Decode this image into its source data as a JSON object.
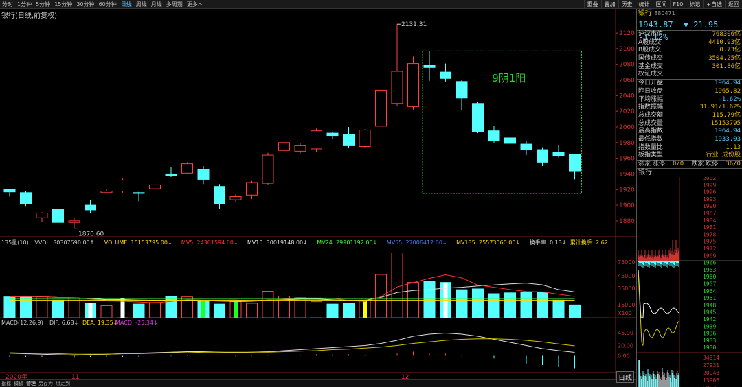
{
  "toolbar": {
    "periods": [
      "分时",
      "1分钟",
      "5分钟",
      "15分钟",
      "30分钟",
      "60分钟",
      "日线",
      "周线",
      "月线",
      "多周期",
      "更多>"
    ],
    "active_period": "日线",
    "right_buttons": [
      "重叠",
      "叠加",
      "历史",
      "统计",
      "区间",
      "F10",
      "标记",
      "+自选",
      "返回"
    ]
  },
  "chart_title": "银行(日线,前复权)",
  "annotations": {
    "high_label": "2131.31",
    "low_label": "1870.60",
    "pattern_text": "9阴1阳"
  },
  "price_axis": [
    "2120",
    "2100",
    "2080",
    "2060",
    "2040",
    "2020",
    "2000",
    "1980",
    "1960",
    "1940",
    "1920",
    "1900",
    "1880"
  ],
  "volume_header": {
    "ind": "135量(10)",
    "vvol": "VVOL: 30307590.00↑",
    "volume": "VOLUME: 15153795.00↓",
    "mv5": "MV5: 24301594.00↓",
    "mv10": "MV10: 30019148.00↓",
    "mv24": "MV24: 29901192.00↓",
    "mv55": "MV55: 27006412.00↓",
    "mv135": "MV135: 25573060.00↓",
    "hsl": "换手率: 0.13↓",
    "ljhs": "累计换手: 2.62"
  },
  "volume_axis": [
    "75000",
    "45000",
    "35000",
    "15000",
    "X100"
  ],
  "macd_header": {
    "name": "MACD(12,26,9)",
    "dif": "DIF: 6.68↓",
    "dea": "DEA: 19.35↓",
    "macd": "MACD: -25.34↓"
  },
  "macd_axis": [
    "45.00",
    "20.00",
    "0.00"
  ],
  "time_axis": [
    "2020年",
    "11",
    "12"
  ],
  "bottom_tabs": [
    "指标",
    "模板",
    "管理",
    "另存为",
    "绑定到"
  ],
  "day_button": "日线",
  "side": {
    "name": "银行",
    "code": "880471",
    "price": "1943.87",
    "change": "▼-21.95",
    "pct": "-1.12%",
    "stats1": [
      {
        "k": "沪深市值",
        "v": "768306亿"
      },
      {
        "k": "A股成交",
        "v": "4410.93亿"
      },
      {
        "k": "B股成交",
        "v": "0.73亿"
      },
      {
        "k": "国债成交",
        "v": "3504.25亿"
      },
      {
        "k": "基金成交",
        "v": "301.86亿"
      },
      {
        "k": "权证成交",
        "v": ""
      }
    ],
    "stats2": [
      {
        "k": "今日开盘",
        "v": "1964.94"
      },
      {
        "k": "昨日收盘",
        "v": "1965.82"
      },
      {
        "k": "平均涨幅",
        "v": "-1.62%"
      },
      {
        "k": "指数振幅",
        "v": "31.91/1.62%"
      },
      {
        "k": "总成交额",
        "v": "115.79亿"
      },
      {
        "k": "总成交量",
        "v": "15153795"
      },
      {
        "k": "最高指数",
        "v": "1964.94"
      },
      {
        "k": "最低指数",
        "v": "1933.03"
      },
      {
        "k": "指数量比",
        "v": "1.13"
      },
      {
        "k": "板指类型",
        "v": "行业 成份股"
      }
    ],
    "updown": {
      "a": "涨家.涨停",
      "av": "0/0",
      "b": "跌家.跌停",
      "bv": "36/0"
    },
    "mini_title": "银行",
    "mini_axis": [
      "2002",
      "1999",
      "1996",
      "1993",
      "1990",
      "1987",
      "1984",
      "1981",
      "1978",
      "1975",
      "1972",
      "1969",
      "1966",
      "1963",
      "1960",
      "1957",
      "1954",
      "1951",
      "1948",
      "1945",
      "1942",
      "1939",
      "1936",
      "1933",
      "1930"
    ],
    "mini_vol_axis": [
      "34914",
      "27931",
      "20948",
      "13966",
      "6983"
    ]
  },
  "chart_data": {
    "type": "candlestick",
    "x_labels": [
      "2020年",
      "11",
      "12"
    ],
    "candles": [
      {
        "o": 1920,
        "c": 1917,
        "h": 1921,
        "l": 1911
      },
      {
        "o": 1916,
        "c": 1902,
        "h": 1918,
        "l": 1899
      },
      {
        "o": 1884,
        "c": 1890,
        "h": 1891,
        "l": 1879
      },
      {
        "o": 1895,
        "c": 1878,
        "h": 1904,
        "l": 1874
      },
      {
        "o": 1878,
        "c": 1880,
        "h": 1884,
        "l": 1870.6
      },
      {
        "o": 1900,
        "c": 1894,
        "h": 1907,
        "l": 1890
      },
      {
        "o": 1916,
        "c": 1918,
        "h": 1921,
        "l": 1915
      },
      {
        "o": 1918,
        "c": 1932,
        "h": 1934,
        "l": 1916
      },
      {
        "o": 1916,
        "c": 1915,
        "h": 1917,
        "l": 1905
      },
      {
        "o": 1921,
        "c": 1926,
        "h": 1928,
        "l": 1919
      },
      {
        "o": 1940,
        "c": 1938,
        "h": 1949,
        "l": 1936
      },
      {
        "o": 1941,
        "c": 1953,
        "h": 1955,
        "l": 1940
      },
      {
        "o": 1946,
        "c": 1933,
        "h": 1950,
        "l": 1927
      },
      {
        "o": 1924,
        "c": 1902,
        "h": 1927,
        "l": 1895
      },
      {
        "o": 1907,
        "c": 1911,
        "h": 1914,
        "l": 1904
      },
      {
        "o": 1913,
        "c": 1929,
        "h": 1931,
        "l": 1908
      },
      {
        "o": 1928,
        "c": 1964,
        "h": 1967,
        "l": 1926
      },
      {
        "o": 1970,
        "c": 1980,
        "h": 1983,
        "l": 1965
      },
      {
        "o": 1969,
        "c": 1976,
        "h": 1979,
        "l": 1966
      },
      {
        "o": 1972,
        "c": 1995,
        "h": 1998,
        "l": 1968
      },
      {
        "o": 1992,
        "c": 1989,
        "h": 1993,
        "l": 1985
      },
      {
        "o": 1990,
        "c": 1976,
        "h": 2000,
        "l": 1973
      },
      {
        "o": 1975,
        "c": 1996,
        "h": 1997,
        "l": 1974
      },
      {
        "o": 2001,
        "c": 2047,
        "h": 2055,
        "l": 1998
      },
      {
        "o": 2030,
        "c": 2071,
        "h": 2131.31,
        "l": 2027
      },
      {
        "o": 2026,
        "c": 2081,
        "h": 2090,
        "l": 2022
      },
      {
        "o": 2079,
        "c": 2076,
        "h": 2097,
        "l": 2059
      },
      {
        "o": 2070,
        "c": 2062,
        "h": 2081,
        "l": 2058
      },
      {
        "o": 2058,
        "c": 2037,
        "h": 2060,
        "l": 2021
      },
      {
        "o": 2030,
        "c": 1994,
        "h": 2032,
        "l": 1992
      },
      {
        "o": 1995,
        "c": 1982,
        "h": 2001,
        "l": 1980
      },
      {
        "o": 1986,
        "c": 1979,
        "h": 2002,
        "l": 1978
      },
      {
        "o": 1978,
        "c": 1971,
        "h": 1982,
        "l": 1964
      },
      {
        "o": 1971,
        "c": 1955,
        "h": 1974,
        "l": 1950
      },
      {
        "o": 1968,
        "c": 1963,
        "h": 1977,
        "l": 1961
      },
      {
        "o": 1964.94,
        "c": 1943.87,
        "h": 1964.94,
        "l": 1933.03
      }
    ],
    "volume": [
      130,
      135,
      130,
      110,
      120,
      90,
      75,
      120,
      85,
      95,
      135,
      130,
      105,
      85,
      100,
      90,
      165,
      135,
      125,
      100,
      85,
      90,
      110,
      270,
      405,
      220,
      225,
      220,
      175,
      180,
      150,
      155,
      160,
      160,
      110,
      80
    ],
    "volume_unit": "X100",
    "macd_bars": [
      -2,
      -3,
      -3,
      -4,
      -4,
      -3,
      -3,
      -2,
      -2,
      -2,
      -1,
      1,
      1,
      0,
      -1,
      1,
      1,
      2,
      2,
      3,
      3,
      3,
      2,
      4,
      6,
      8,
      6,
      4,
      2,
      0,
      -5,
      -10,
      -15,
      -18,
      -22,
      -25.34
    ],
    "dif": [
      5,
      4,
      3,
      2,
      1,
      2,
      3,
      4,
      5,
      6,
      7,
      8,
      8,
      7,
      6,
      7,
      8,
      10,
      12,
      14,
      16,
      18,
      20,
      24,
      30,
      38,
      42,
      44,
      42,
      38,
      32,
      26,
      20,
      14,
      10,
      6.68
    ],
    "dea": [
      6,
      5,
      5,
      4,
      3,
      3,
      3,
      4,
      4,
      5,
      6,
      6,
      7,
      7,
      7,
      7,
      7,
      8,
      9,
      10,
      12,
      13,
      15,
      17,
      20,
      24,
      27,
      30,
      32,
      33,
      33,
      32,
      30,
      27,
      23,
      19.35
    ]
  }
}
